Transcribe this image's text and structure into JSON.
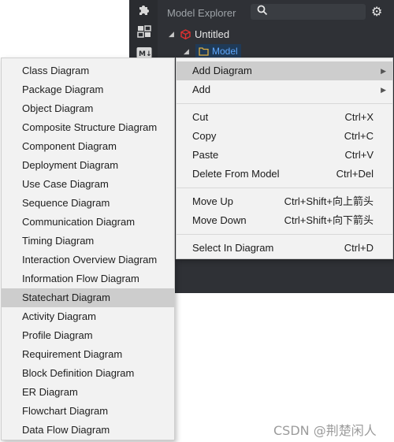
{
  "explorer": {
    "title": "Model Explorer",
    "tree": {
      "root_label": "Untitled",
      "child_label": "Model"
    }
  },
  "icons": {
    "puzzle": "extension-icon",
    "layout": "layout-icon",
    "markdown": "markdown-icon",
    "search": "search-icon",
    "settings": "gear-icon"
  },
  "submenu": {
    "items": [
      "Class Diagram",
      "Package Diagram",
      "Object Diagram",
      "Composite Structure Diagram",
      "Component Diagram",
      "Deployment Diagram",
      "Use Case Diagram",
      "Sequence Diagram",
      "Communication Diagram",
      "Timing Diagram",
      "Interaction Overview Diagram",
      "Information Flow Diagram",
      "Statechart Diagram",
      "Activity Diagram",
      "Profile Diagram",
      "Requirement Diagram",
      "Block Definition Diagram",
      "ER Diagram",
      "Flowchart Diagram",
      "Data Flow Diagram"
    ],
    "highlighted": "Statechart Diagram"
  },
  "menu": {
    "add_diagram": "Add Diagram",
    "add": "Add",
    "cut": {
      "label": "Cut",
      "shortcut": "Ctrl+X"
    },
    "copy": {
      "label": "Copy",
      "shortcut": "Ctrl+C"
    },
    "paste": {
      "label": "Paste",
      "shortcut": "Ctrl+V"
    },
    "delete": {
      "label": "Delete From Model",
      "shortcut": "Ctrl+Del"
    },
    "move_up": {
      "label": "Move Up",
      "shortcut": "Ctrl+Shift+向上箭头"
    },
    "move_down": {
      "label": "Move Down",
      "shortcut": "Ctrl+Shift+向下箭头"
    },
    "select": {
      "label": "Select In Diagram",
      "shortcut": "Ctrl+D"
    }
  },
  "watermark": "CSDN @荆楚闲人",
  "colors": {
    "app_bg": "#2f3136",
    "menu_bg": "#f2f2f2",
    "highlight": "#cdcdcd",
    "tree_selected_text": "#5fa8ff",
    "cube_red": "#e03030",
    "folder_yellow": "#e0b040"
  }
}
